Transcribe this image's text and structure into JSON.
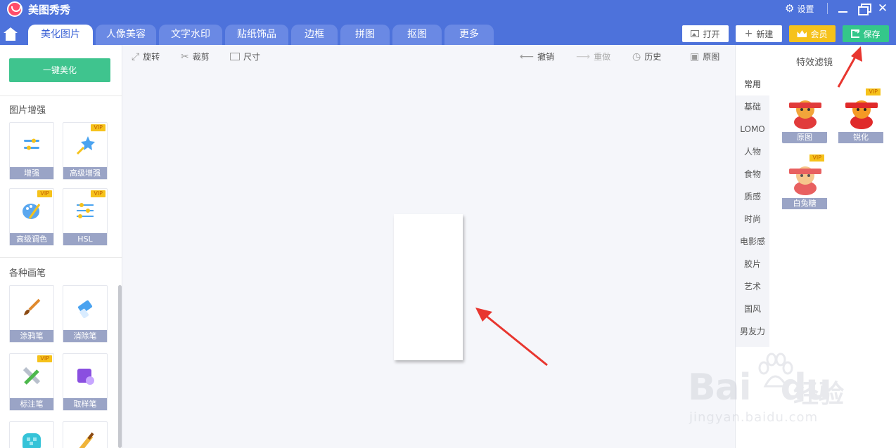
{
  "app": {
    "title": "美图秀秀",
    "settings_label": "设置"
  },
  "tabs": [
    "美化图片",
    "人像美容",
    "文字水印",
    "贴纸饰品",
    "边框",
    "拼图",
    "抠图",
    "更多"
  ],
  "top_buttons": {
    "open": "打开",
    "new": "新建",
    "vip": "会员",
    "save": "保存"
  },
  "left": {
    "one_key": "一键美化",
    "section1": "图片增强",
    "section1_tools": [
      {
        "label": "增强",
        "vip": false
      },
      {
        "label": "高级增强",
        "vip": true
      },
      {
        "label": "高级调色",
        "vip": true
      },
      {
        "label": "HSL",
        "vip": true
      }
    ],
    "section2": "各种画笔",
    "section2_tools": [
      {
        "label": "涂鸦笔",
        "vip": false
      },
      {
        "label": "消除笔",
        "vip": false
      },
      {
        "label": "标注笔",
        "vip": true
      },
      {
        "label": "取样笔",
        "vip": false
      }
    ],
    "vip_badge": "VIP"
  },
  "toolbar": {
    "rotate": "旋转",
    "crop": "裁剪",
    "size": "尺寸",
    "undo": "撤销",
    "redo": "重做",
    "history": "历史",
    "original": "原图"
  },
  "right": {
    "title": "特效滤镜",
    "categories": [
      "常用",
      "基础",
      "LOMO",
      "人物",
      "食物",
      "质感",
      "时尚",
      "电影感",
      "胶片",
      "艺术",
      "国风",
      "男友力"
    ],
    "filters": [
      {
        "label": "原图",
        "vip": false
      },
      {
        "label": "锐化",
        "vip": true
      },
      {
        "label": "白兔糖",
        "vip": true
      }
    ]
  },
  "watermark": {
    "brand": "Bai",
    "brand2": "du",
    "cn": "经验",
    "url": "jingyan.baidu.com"
  },
  "colors": {
    "topbar": "#4d72db",
    "save_green": "#34c78a",
    "vip_gold": "#f6c21b",
    "arrow_red": "#e8362f"
  }
}
